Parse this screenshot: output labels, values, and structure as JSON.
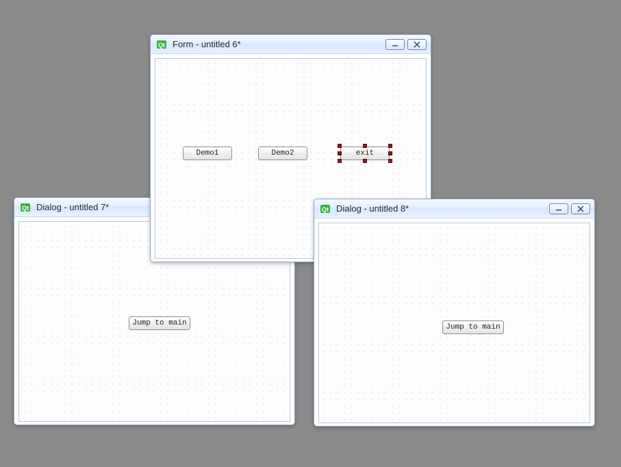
{
  "windows": {
    "form": {
      "title": "Form - untitled 6*",
      "buttons": {
        "demo1": "Demo1",
        "demo2": "Demo2",
        "exit": "exit"
      },
      "selected_button": "exit"
    },
    "dialog7": {
      "title": "Dialog - untitled 7*",
      "buttons": {
        "jump_to_main": "Jump to main"
      }
    },
    "dialog8": {
      "title": "Dialog - untitled 8*",
      "buttons": {
        "jump_to_main": "Jump to main"
      }
    }
  },
  "icons": {
    "minimize": "minimize",
    "close": "close",
    "qt": "qt-designer"
  }
}
